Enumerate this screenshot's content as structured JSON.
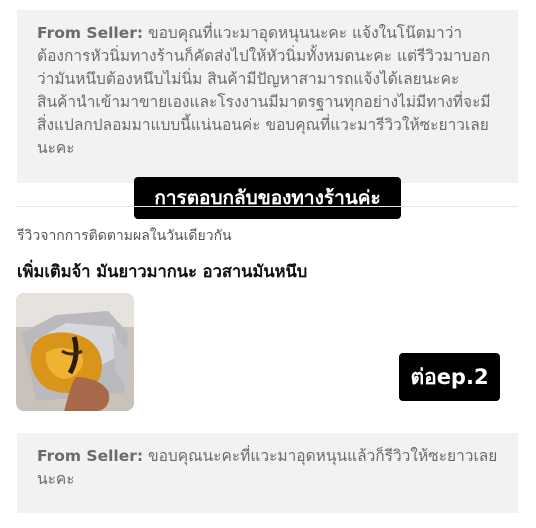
{
  "seller_reply_top": {
    "label": "From Seller:",
    "text": "ขอบคุณที่แวะมาอุดหนุนนะคะ แจ้งในโน๊ตมาว่าต้องการหัวนิ่มทางร้านก็คัดส่งไปให้หัวนิ่มทั้งหมดนะคะ แต่รีวิวมาบอกว่ามันหนึบต้องหนึบไม่นิ่ม สินค้ามีปัญหาสามารถแจ้งได้เลยนะคะสินค้านำเข้ามาขายเองและโรงงานมีมาตรฐานทุกอย่างไม่มีทางที่จะมีสิ่งแปลกปลอมมาแบบนี้แน่นอนค่ะ ขอบคุณที่แวะมารีวิวให้ซะยาวเลยนะคะ"
  },
  "overlay_reply_tag": "การตอบกลับของทางร้านค่ะ",
  "followup_review": {
    "subtitle": "รีวิวจากการติดตามผลในวันเดียวกัน",
    "text": "เพิ่มเติมจ้า มันยาวมากนะ อวสานมันหนึบ"
  },
  "overlay_ep_tag": "ต่อep.2",
  "seller_reply_bottom": {
    "label": "From Seller:",
    "text": "ขอบคุณนะคะที่แวะมาอุดหนุนแล้วก็รีวิวให้ซะยาวเลยนะคะ"
  }
}
